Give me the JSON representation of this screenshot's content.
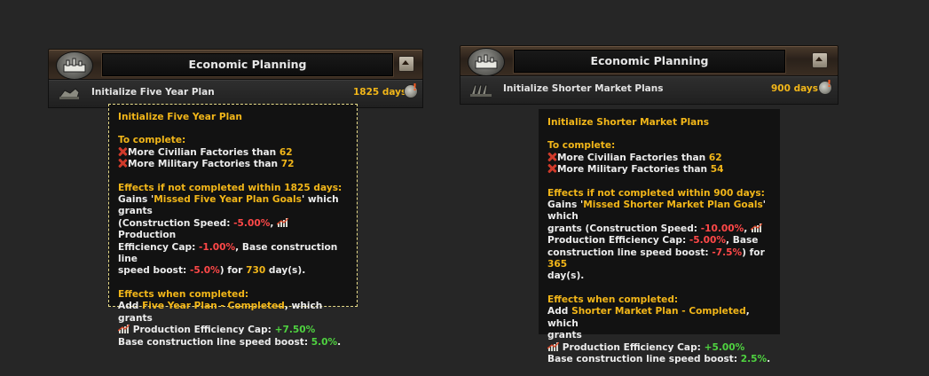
{
  "colors": {
    "gold": "#f2b619",
    "red": "#ff4848",
    "green": "#4fd240"
  },
  "left": {
    "header_title": "Economic Planning",
    "decision_label": "Initialize Five Year Plan",
    "decision_days": "1825 days",
    "tooltip": {
      "title": "Initialize Five Year Plan",
      "to_complete": "To complete:",
      "req_civ_text": "More Civilian Factories than ",
      "req_civ_value": "62",
      "req_mil_text": "More Military Factories than ",
      "req_mil_value": "72",
      "fail_heading": "Effects if not completed within 1825 days:",
      "gains_prefix": "Gains '",
      "gains_name": "Missed Five Year Plan Goals",
      "gains_suffix": "' which grants",
      "cs_label": "(Construction Speed: ",
      "cs_value": "-5.00%",
      "pe_inline_label": "Production",
      "pe_inline_label2": "Efficiency Cap: ",
      "pe_value": "-1.00%",
      "bc_label": ", Base construction line",
      "bc_label2": "speed boost: ",
      "bc_value": "-5.0%",
      "dur_mid": ") for ",
      "dur_value": "730",
      "dur_end": " day(s).",
      "complete_heading": "Effects when completed:",
      "add_prefix": "Add ",
      "add_name": "Five Year Plan - Completed",
      "add_suffix": ", which grants",
      "pe_label": "Production Efficiency Cap: ",
      "pe_complete_value": "+7.50%",
      "bcl_label": "Base construction line speed boost: ",
      "bcl_value": "5.0%",
      "period": "."
    }
  },
  "right": {
    "header_title": "Economic Planning",
    "decision_label": "Initialize Shorter Market Plans",
    "decision_days": "900 days",
    "tooltip": {
      "title": "Initialize Shorter Market Plans",
      "to_complete": "To complete:",
      "req_civ_text": "More Civilian Factories than ",
      "req_civ_value": "62",
      "req_mil_text": "More Military Factories than ",
      "req_mil_value": "54",
      "fail_heading": "Effects if not completed within 900 days:",
      "gains_prefix": "Gains '",
      "gains_name": "Missed Shorter Market Plan Goals",
      "gains_suffix": "' which",
      "gains_suffix2": "grants (Construction Speed: ",
      "cs_value": "-10.00%",
      "pe_label": "Production Efficiency Cap: ",
      "pe_value": "-5.00%",
      "bc_label": ", Base",
      "bc_label2": "construction line speed boost: ",
      "bc_value": "-7.5%",
      "dur_mid": ") for ",
      "dur_value": "365",
      "dur_end": "day(s).",
      "complete_heading": "Effects when completed:",
      "add_prefix": "Add ",
      "add_name": "Shorter Market Plan - Completed",
      "add_suffix": ", which",
      "add_suffix2": "grants",
      "pe_complete_label": "Production Efficiency Cap: ",
      "pe_complete_value": "+5.00%",
      "bcl_label": "Base construction line speed boost: ",
      "bcl_value": "2.5%",
      "period": "."
    }
  }
}
